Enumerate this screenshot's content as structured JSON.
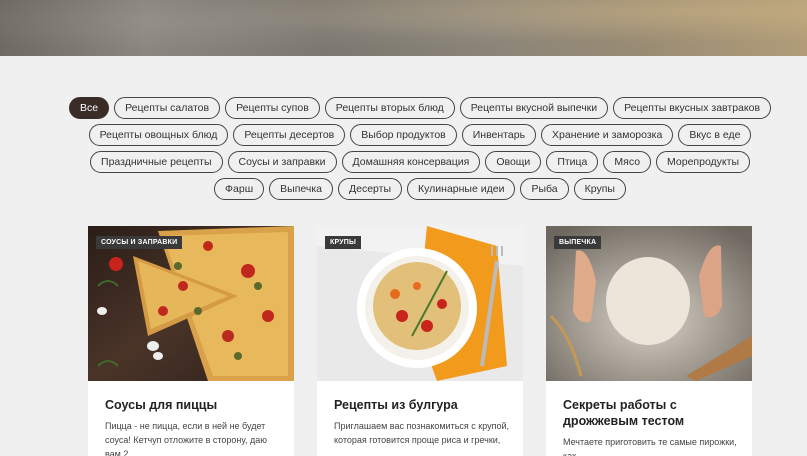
{
  "filters": {
    "rows": [
      [
        "Все",
        "Рецепты салатов",
        "Рецепты супов",
        "Рецепты вторых блюд",
        "Рецепты вкусной выпечки",
        "Рецепты вкусных завтраков"
      ],
      [
        "Рецепты овощных блюд",
        "Рецепты десертов",
        "Выбор продуктов",
        "Инвентарь",
        "Хранение и заморозка",
        "Вкус в еде"
      ],
      [
        "Праздничные рецепты",
        "Соусы и заправки",
        "Домашняя консервация",
        "Овощи",
        "Птица",
        "Мясо",
        "Морепродукты"
      ],
      [
        "Фарш",
        "Выпечка",
        "Десерты",
        "Кулинарные идеи",
        "Рыба",
        "Крупы"
      ]
    ],
    "active": "Все"
  },
  "cards": [
    {
      "badge": "СОУСЫ И ЗАПРАВКИ",
      "title": "Соусы для пиццы",
      "excerpt": "Пицца - не пицца, если в ней не будет соуса! Кетчуп отложите в сторону, даю вам 2"
    },
    {
      "badge": "КРУПЫ",
      "title": "Рецепты из булгура",
      "excerpt": "Приглашаем вас познакомиться с крупой, которая готовится проще риса и гречки,"
    },
    {
      "badge": "ВЫПЕЧКА",
      "title": "Секреты работы с дрожжевым тестом",
      "excerpt": "Мечтаете приготовить те самые пирожки, как"
    }
  ]
}
